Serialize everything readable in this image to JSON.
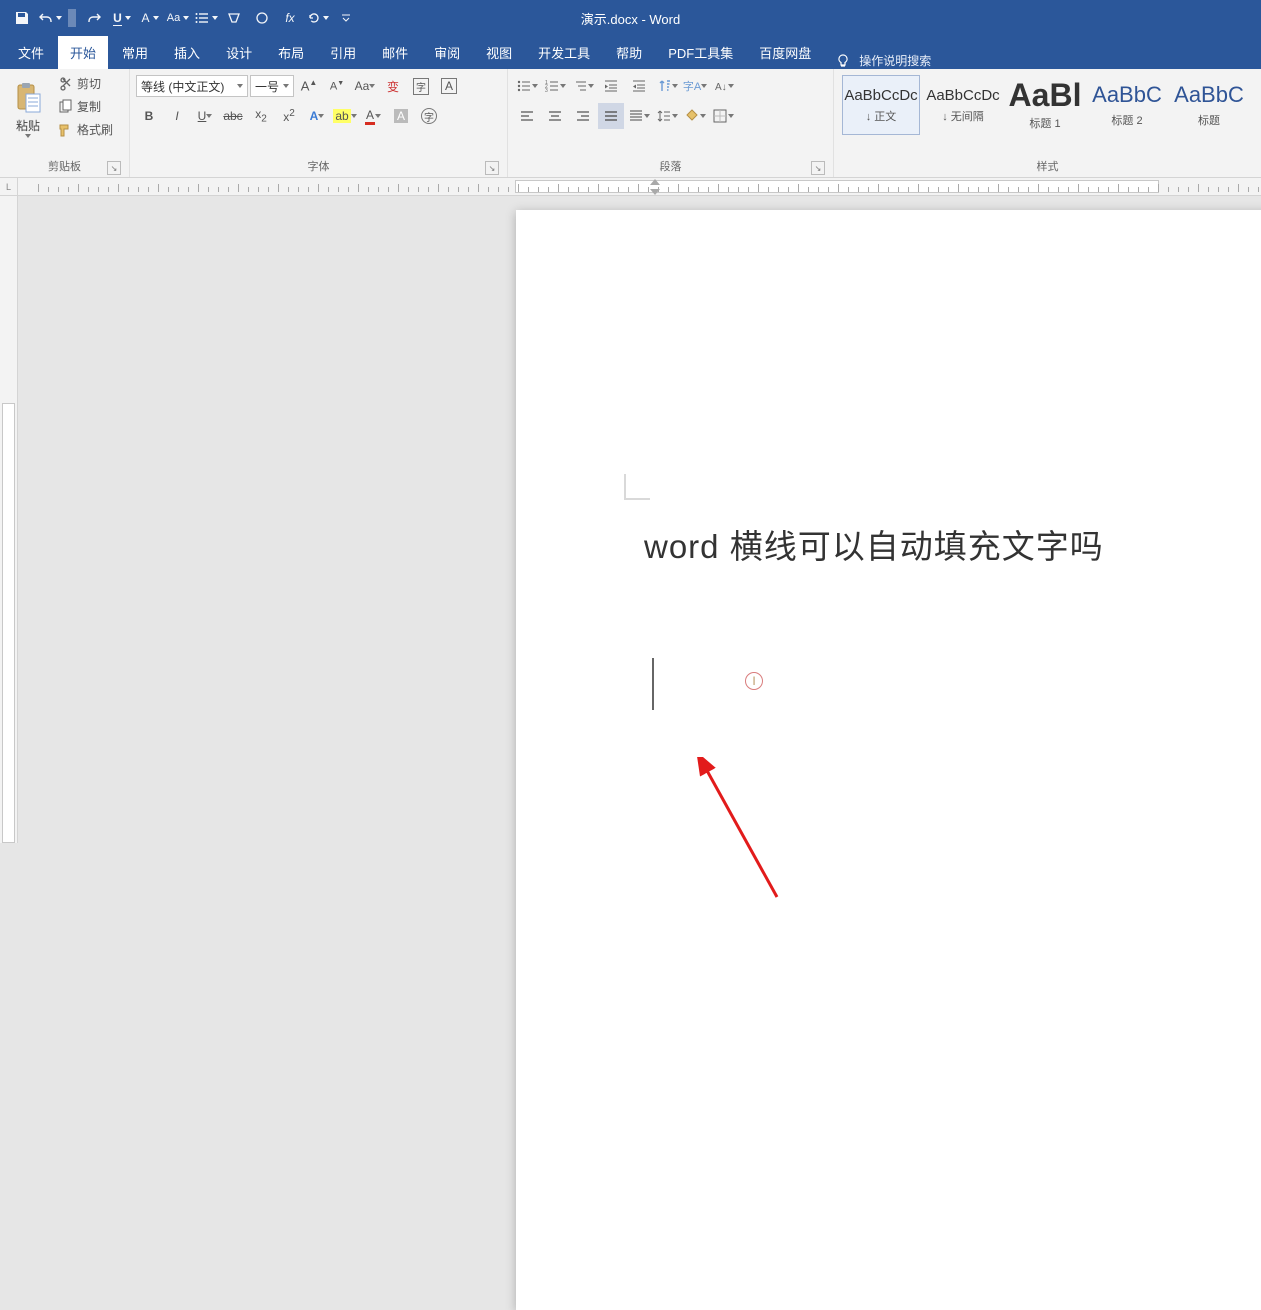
{
  "window": {
    "title": "演示.docx  -  Word"
  },
  "qat": {
    "items": [
      "save",
      "undo",
      "redo"
    ]
  },
  "tabs": {
    "file": "文件",
    "active": "开始",
    "list": [
      "常用",
      "插入",
      "设计",
      "布局",
      "引用",
      "邮件",
      "审阅",
      "视图",
      "开发工具",
      "帮助",
      "PDF工具集",
      "百度网盘"
    ],
    "tellme": "操作说明搜索"
  },
  "clipboard": {
    "paste": "粘贴",
    "cut": "剪切",
    "copy": "复制",
    "formatPainter": "格式刷",
    "group": "剪贴板"
  },
  "font": {
    "name": "等线 (中文正文)",
    "size": "一号",
    "group": "字体"
  },
  "paragraph": {
    "group": "段落"
  },
  "styles": {
    "group": "样式",
    "items": [
      {
        "sample": "AaBbCcDc",
        "name": "↓ 正文",
        "sizeClass": "",
        "selected": true
      },
      {
        "sample": "AaBbCcDc",
        "name": "↓ 无间隔",
        "sizeClass": "",
        "selected": false
      },
      {
        "sample": "AaBl",
        "name": "标题 1",
        "sizeClass": "big",
        "selected": false
      },
      {
        "sample": "AaBbC",
        "name": "标题 2",
        "sizeClass": "med",
        "selected": false
      },
      {
        "sample": "AaBbC",
        "name": "标题",
        "sizeClass": "med",
        "selected": false
      }
    ]
  },
  "ruler": {
    "corner": "L"
  },
  "document": {
    "heading": "word 横线可以自动填充文字吗"
  },
  "cursorGlyph": "I"
}
